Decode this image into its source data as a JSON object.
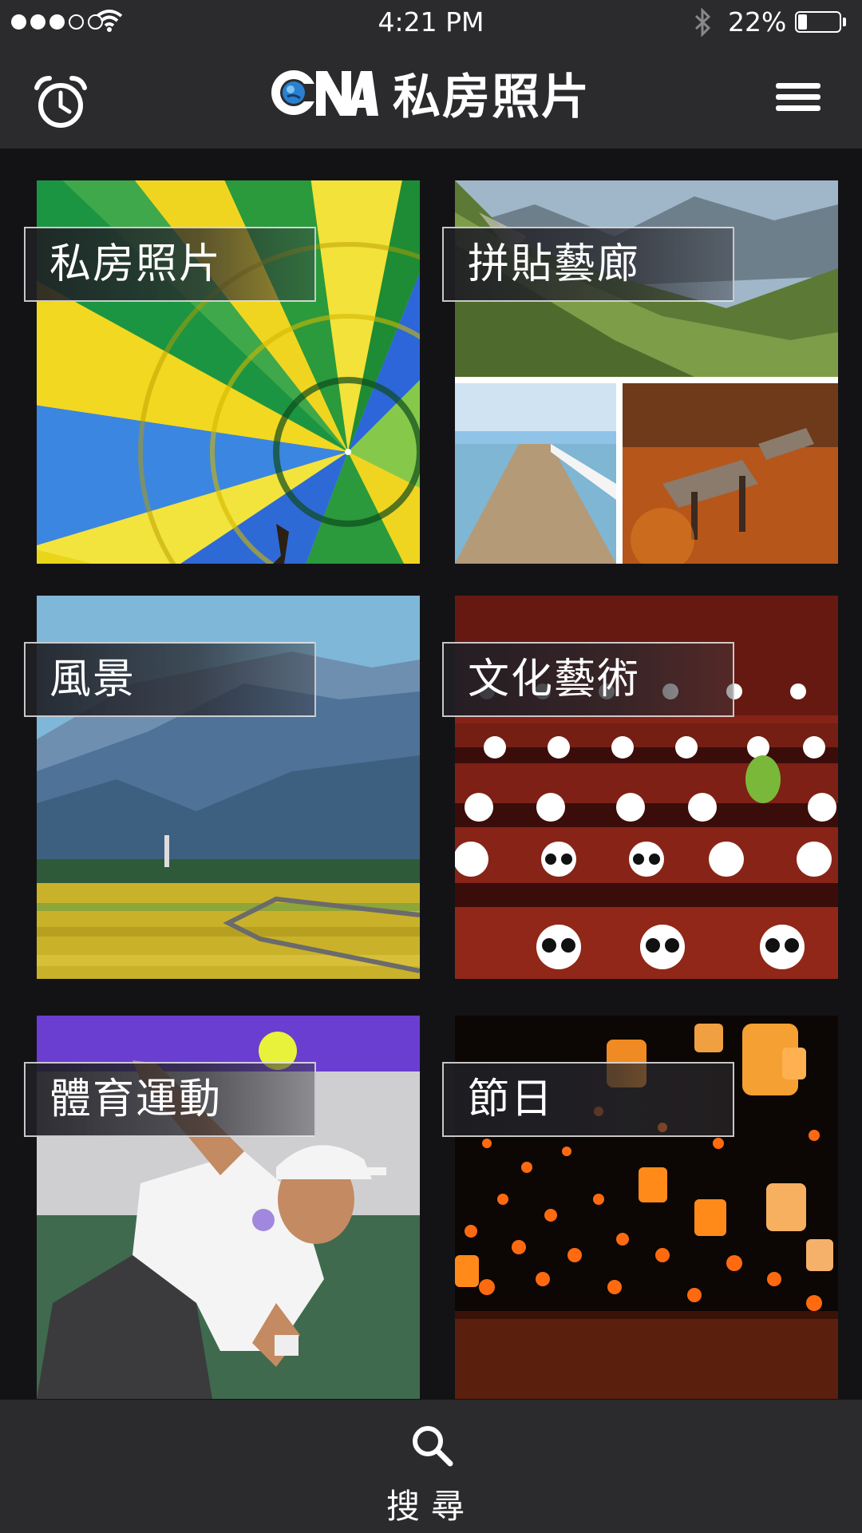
{
  "status_bar": {
    "time": "4:21 PM",
    "battery_percent": "22%",
    "battery_level": 0.22,
    "signal_bars": 3,
    "signal_total": 5
  },
  "header": {
    "logo_text": "CNA",
    "title": "私房照片",
    "left_icon": "alarm-clock-icon",
    "right_icon": "hamburger-menu-icon"
  },
  "categories": [
    {
      "label": "私房照片"
    },
    {
      "label": "拼貼藝廊"
    },
    {
      "label": "風景"
    },
    {
      "label": "文化藝術"
    },
    {
      "label": "體育運動"
    },
    {
      "label": "節日"
    }
  ],
  "bottom_bar": {
    "search_label": "搜尋",
    "icon": "search-icon"
  }
}
